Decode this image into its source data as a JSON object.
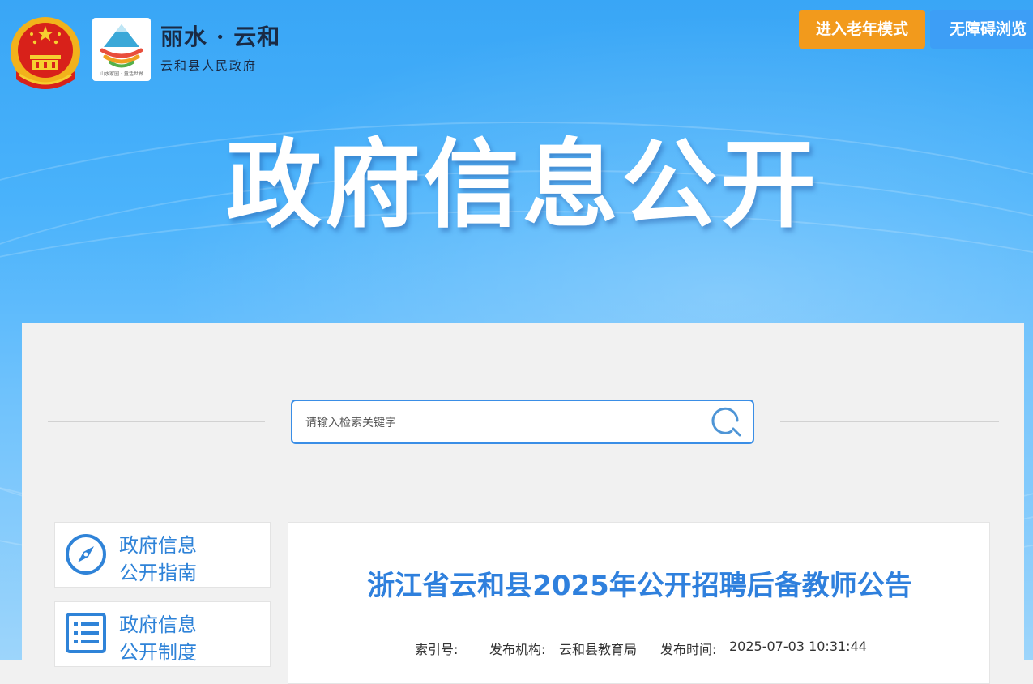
{
  "header": {
    "site_name": "丽水 · 云和",
    "site_subtitle": "云和县人民政府",
    "logo_slogan": "山水家园 · 童话世界",
    "elder_mode_button": "进入老年模式",
    "accessibility_button": "无障碍浏览"
  },
  "banner": {
    "title": "政府信息公开"
  },
  "search": {
    "placeholder": "请输入检索关键字"
  },
  "sidebar": {
    "items": [
      {
        "line1": "政府信息",
        "line2": "公开指南",
        "icon": "compass-icon"
      },
      {
        "line1": "政府信息",
        "line2": "公开制度",
        "icon": "list-icon"
      }
    ]
  },
  "article": {
    "title": "浙江省云和县2025年公开招聘后备教师公告",
    "meta": {
      "index_label": "索引号:",
      "index_value": "",
      "publisher_label": "发布机构:",
      "publisher_value": "云和县教育局",
      "time_label": "发布时间:",
      "time_value": "2025-07-03 10:31:44"
    }
  },
  "colors": {
    "banner_blue": "#49b2fb",
    "elder_button": "#f29a1c",
    "access_button": "#3d9ef6",
    "accent_blue": "#2f80dd"
  }
}
